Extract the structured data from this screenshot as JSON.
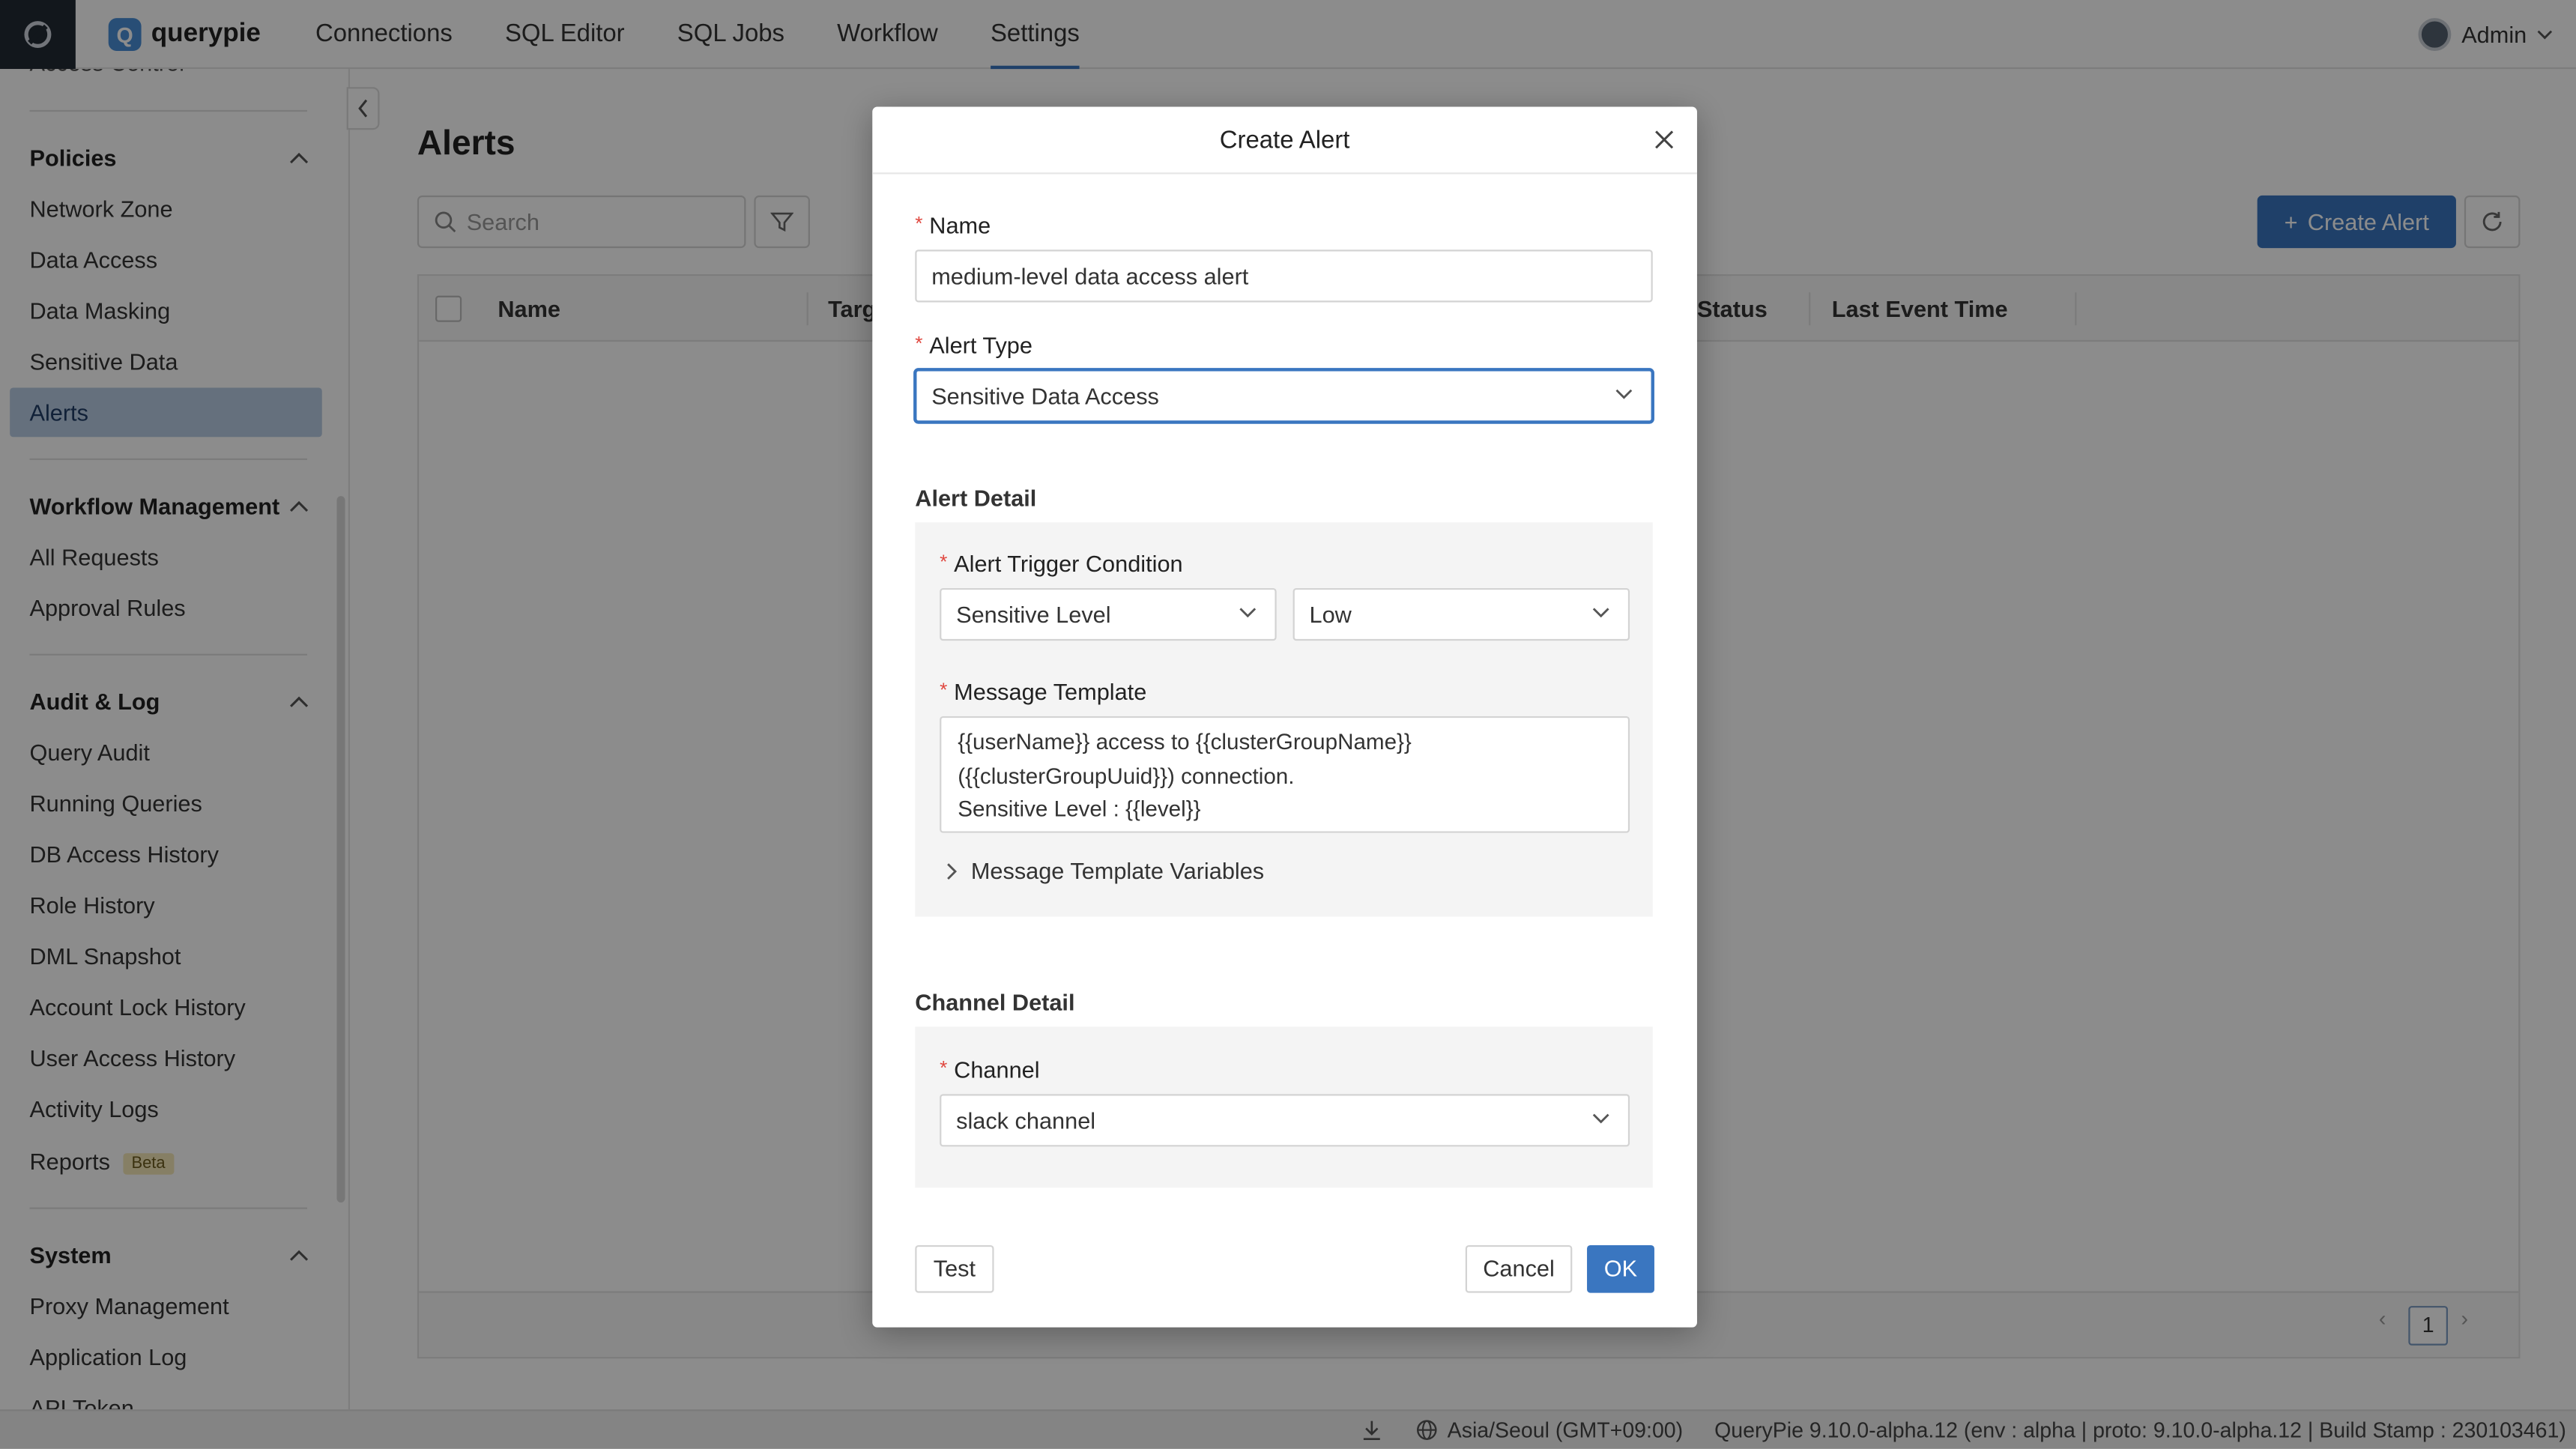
{
  "header": {
    "brand": "querypie",
    "nav": [
      "Connections",
      "SQL Editor",
      "SQL Jobs",
      "Workflow",
      "Settings"
    ],
    "active_nav": "Settings",
    "user": "Admin"
  },
  "sidebar": {
    "cut_item": "Access Control",
    "sections": [
      {
        "title": "Policies",
        "items": [
          "Network Zone",
          "Data Access",
          "Data Masking",
          "Sensitive Data",
          "Alerts"
        ]
      },
      {
        "title": "Workflow Management",
        "items": [
          "All Requests",
          "Approval Rules"
        ]
      },
      {
        "title": "Audit & Log",
        "items": [
          "Query Audit",
          "Running Queries",
          "DB Access History",
          "Role History",
          "DML Snapshot",
          "Account Lock History",
          "User Access History",
          "Activity Logs",
          "Reports"
        ]
      },
      {
        "title": "System",
        "items": [
          "Proxy Management",
          "Application Log",
          "API Token"
        ]
      }
    ],
    "active_item": "Alerts",
    "beta_badge": "Beta"
  },
  "main": {
    "title": "Alerts",
    "search_placeholder": "Search",
    "create_button": "Create Alert",
    "columns": [
      "Name",
      "Target",
      "Status",
      "Last Event Time"
    ],
    "current_page": "1"
  },
  "status_bar": {
    "timezone": "Asia/Seoul (GMT+09:00)",
    "version": "QueryPie 9.10.0-alpha.12 (env : alpha | proto: 9.10.0-alpha.12 | Build Stamp : 230103461)"
  },
  "modal": {
    "title": "Create Alert",
    "name_label": "Name",
    "name_value": "medium-level data access alert",
    "alert_type_label": "Alert Type",
    "alert_type_value": "Sensitive Data Access",
    "alert_detail_title": "Alert Detail",
    "trigger_label": "Alert Trigger Condition",
    "trigger_field": "Sensitive Level",
    "trigger_value": "Low",
    "template_label": "Message Template",
    "template_lines": [
      "{{userName}} access to {{clusterGroupName}}",
      "({{clusterGroupUuid}}) connection.",
      "Sensitive Level : {{level}}"
    ],
    "template_vars": "Message Template Variables",
    "channel_detail_title": "Channel Detail",
    "channel_label": "Channel",
    "channel_value": "slack channel",
    "test_button": "Test",
    "cancel_button": "Cancel",
    "ok_button": "OK"
  },
  "colors": {
    "accent": "#3a76c0",
    "required": "#e0473f",
    "active_item_bg": "#b9cde3"
  }
}
